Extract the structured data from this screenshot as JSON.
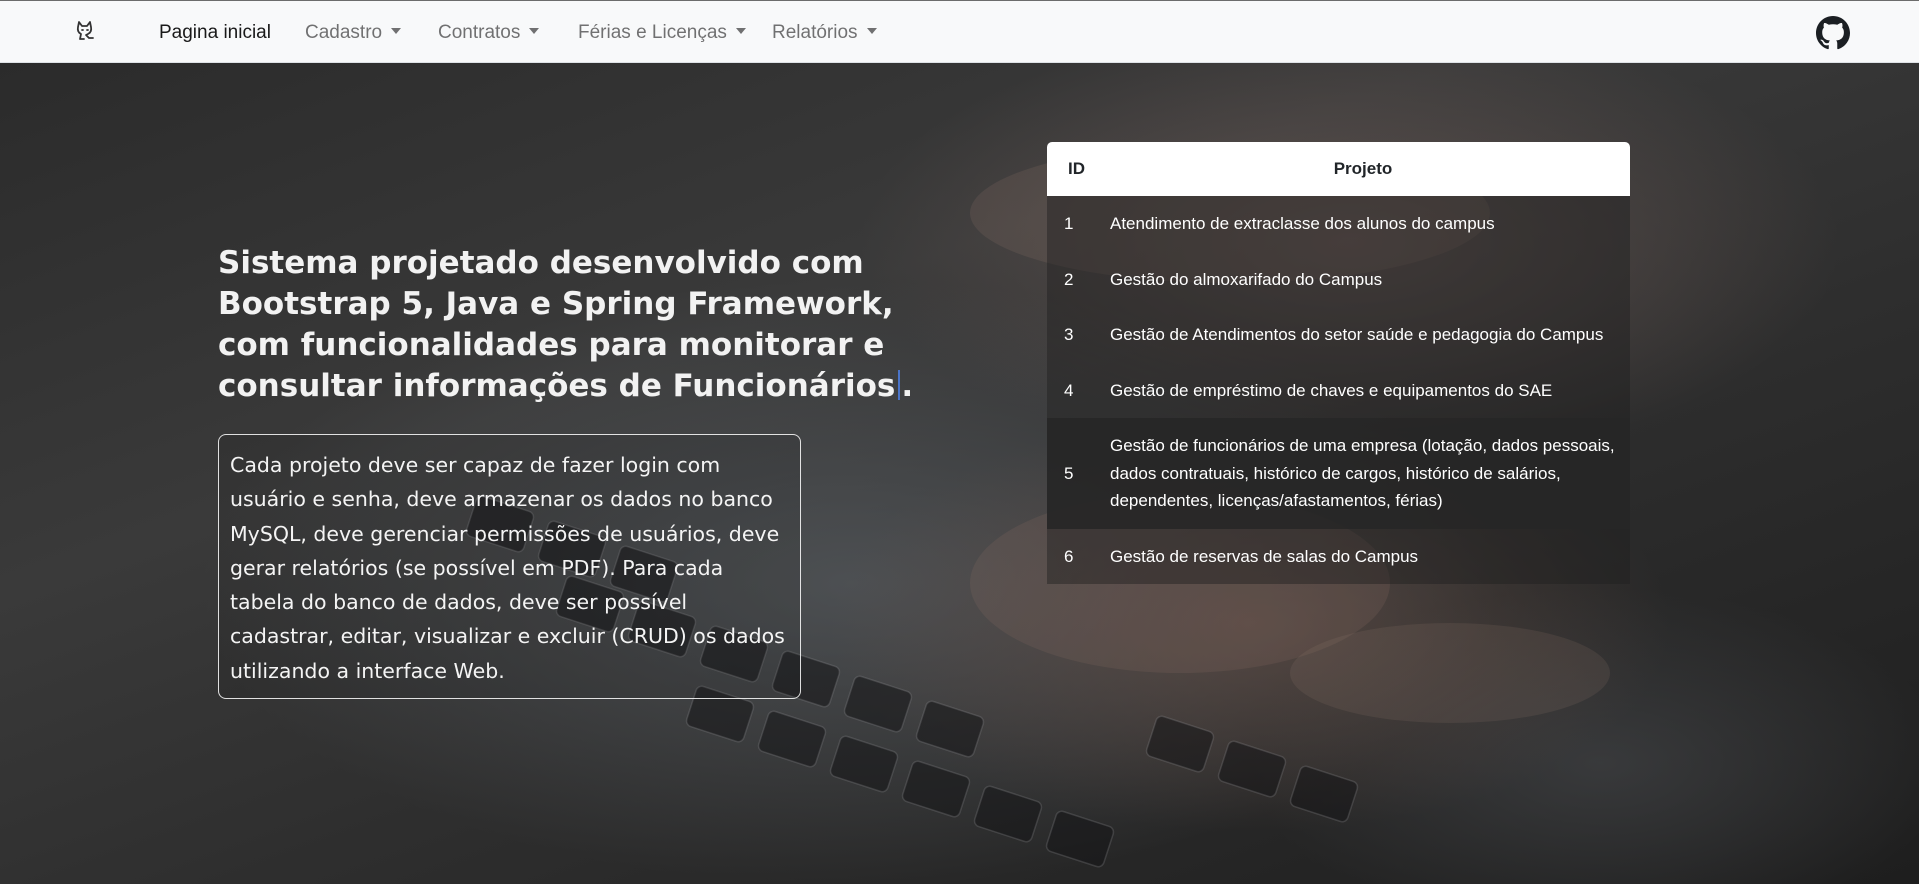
{
  "navbar": {
    "brand_icon": "cat-icon",
    "items": [
      {
        "label": "Pagina inicial",
        "active": true,
        "dropdown": false
      },
      {
        "label": "Cadastro",
        "active": false,
        "dropdown": true
      },
      {
        "label": "Contratos",
        "active": false,
        "dropdown": true
      },
      {
        "label": "Férias e Licenças",
        "active": false,
        "dropdown": true
      },
      {
        "label": "Relatórios",
        "active": false,
        "dropdown": true
      }
    ],
    "github_icon": "github-icon"
  },
  "hero": {
    "headline": "Sistema projetado desenvolvido com Bootstrap 5, Java e Spring Framework, com funcionalidades para monitorar e consultar informações de Funcionários",
    "headline_end": ".",
    "description": "Cada projeto deve ser capaz de fazer login com usuário e senha, deve armazenar os dados no banco MySQL, deve gerenciar permissões de usuários, deve gerar relatórios (se possível em PDF). Para cada tabela do banco de dados, deve ser possível cadastrar, editar, visualizar e excluir (CRUD) os dados utilizando a interface Web."
  },
  "table": {
    "columns": [
      "ID",
      "Projeto"
    ],
    "rows": [
      {
        "id": "1",
        "projeto": "Atendimento de extraclasse dos alunos do campus"
      },
      {
        "id": "2",
        "projeto": "Gestão do almoxarifado do Campus"
      },
      {
        "id": "3",
        "projeto": "Gestão de Atendimentos do setor saúde e pedagogia do Campus"
      },
      {
        "id": "4",
        "projeto": "Gestão de empréstimo de chaves e equipamentos do SAE"
      },
      {
        "id": "5",
        "projeto": "Gestão de funcionários de uma empresa (lotação, dados pessoais, dados contratuais, histórico de cargos, histórico de salários, dependentes, licenças/afastamentos, férias)"
      },
      {
        "id": "6",
        "projeto": "Gestão de reservas de salas do Campus"
      }
    ],
    "hovered_row_id": "5"
  },
  "colors": {
    "navbar_bg": "#f8f9fa",
    "text_light": "#f2f2f2",
    "cursor": "#4a74c9",
    "row_hover": "#262626"
  }
}
